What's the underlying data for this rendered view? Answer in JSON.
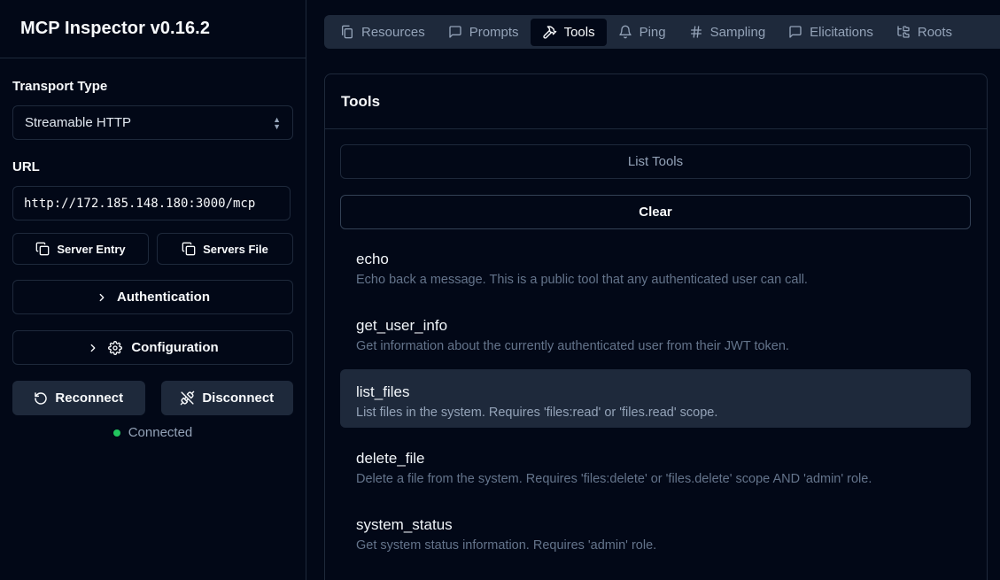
{
  "app": {
    "title": "MCP Inspector v0.16.2"
  },
  "sidebar": {
    "transport_label": "Transport Type",
    "transport_value": "Streamable HTTP",
    "url_label": "URL",
    "url_value": "http://172.185.148.180:3000/mcp",
    "server_entry_label": "Server Entry",
    "servers_file_label": "Servers File",
    "authentication_label": "Authentication",
    "configuration_label": "Configuration",
    "reconnect_label": "Reconnect",
    "disconnect_label": "Disconnect",
    "status_text": "Connected",
    "status_color": "#22c55e"
  },
  "tabs": [
    {
      "label": "Resources",
      "icon": "files-icon"
    },
    {
      "label": "Prompts",
      "icon": "message-square-icon"
    },
    {
      "label": "Tools",
      "icon": "hammer-icon",
      "active": true
    },
    {
      "label": "Ping",
      "icon": "bell-icon"
    },
    {
      "label": "Sampling",
      "icon": "hash-icon"
    },
    {
      "label": "Elicitations",
      "icon": "message-square-icon"
    },
    {
      "label": "Roots",
      "icon": "folder-tree-icon"
    }
  ],
  "tools_panel": {
    "title": "Tools",
    "list_tools_label": "List Tools",
    "clear_label": "Clear",
    "items": [
      {
        "name": "echo",
        "description": "Echo back a message. This is a public tool that any authenticated user can call."
      },
      {
        "name": "get_user_info",
        "description": "Get information about the currently authenticated user from their JWT token."
      },
      {
        "name": "list_files",
        "description": "List files in the system. Requires 'files:read' or 'files.read' scope.",
        "selected": true
      },
      {
        "name": "delete_file",
        "description": "Delete a file from the system. Requires 'files:delete' or 'files.delete' scope AND 'admin' role."
      },
      {
        "name": "system_status",
        "description": "Get system status information. Requires 'admin' role."
      }
    ]
  }
}
